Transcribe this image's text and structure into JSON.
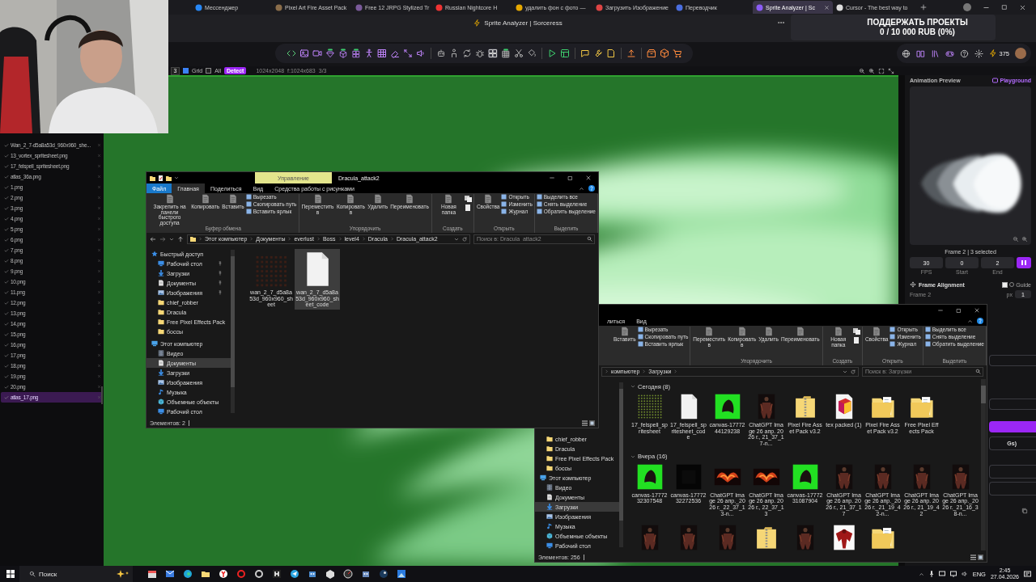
{
  "browser": {
    "tabs": [
      {
        "label": "Мессенджер",
        "selected": false
      },
      {
        "label": "Pixel Art Fire Asset Pack",
        "selected": false
      },
      {
        "label": "Free 12 JRPG Stylized Tr",
        "selected": false
      },
      {
        "label": "Russian Nightcore H",
        "selected": false
      },
      {
        "label": "удалить фон с фото —",
        "selected": false
      },
      {
        "label": "Загрузить Изображение",
        "selected": false
      },
      {
        "label": "Переводчик",
        "selected": false
      },
      {
        "label": "Sprite Analyzer | Sc",
        "selected": true
      },
      {
        "label": "Cursor - The best way to",
        "selected": false
      }
    ],
    "page_title": "Sprite Analyzer | Sorceress"
  },
  "support_banner": {
    "title": "ПОДДЕРЖАТЬ ПРОЕКТЫ",
    "progress": "0 / 10 000 RUB (0%)"
  },
  "toolbar": {
    "credits": "375"
  },
  "canvas_header": {
    "zoom": "3",
    "grid": {
      "label": "Grid",
      "checked": true
    },
    "all": {
      "label": "All",
      "checked": false
    },
    "detect": "Detect",
    "size": "1024x2048",
    "frame_size": "f:1024x683",
    "count": "3/3"
  },
  "file_list": [
    {
      "name": "Wan_2_7-d5a8a53d_960x960_she...",
      "selected": false
    },
    {
      "name": "13_vortex_spritesheet.png",
      "selected": false
    },
    {
      "name": "17_felspell_spritesheet.png",
      "selected": false
    },
    {
      "name": "atlas_36a.png",
      "selected": false
    },
    {
      "name": "1.png",
      "selected": false
    },
    {
      "name": "2.png",
      "selected": false
    },
    {
      "name": "3.png",
      "selected": false
    },
    {
      "name": "4.png",
      "selected": false
    },
    {
      "name": "5.png",
      "selected": false
    },
    {
      "name": "6.png",
      "selected": false
    },
    {
      "name": "7.png",
      "selected": false
    },
    {
      "name": "8.png",
      "selected": false
    },
    {
      "name": "9.png",
      "selected": false
    },
    {
      "name": "10.png",
      "selected": false
    },
    {
      "name": "11.png",
      "selected": false
    },
    {
      "name": "12.png",
      "selected": false
    },
    {
      "name": "13.png",
      "selected": false
    },
    {
      "name": "14.png",
      "selected": false
    },
    {
      "name": "15.png",
      "selected": false
    },
    {
      "name": "16.png",
      "selected": false
    },
    {
      "name": "17.png",
      "selected": false
    },
    {
      "name": "18.png",
      "selected": false
    },
    {
      "name": "19.png",
      "selected": false
    },
    {
      "name": "20.png",
      "selected": false
    },
    {
      "name": "atlas_17.png",
      "selected": true
    }
  ],
  "animation_panel": {
    "title": "Animation Preview",
    "playground": "Playground",
    "frame_info": "Frame 2 | 3 selected",
    "fields": [
      {
        "value": "30",
        "label": "FPS"
      },
      {
        "value": "0",
        "label": "Start"
      },
      {
        "value": "2",
        "label": "End"
      }
    ],
    "alignment": {
      "title": "Frame Alignment",
      "guide": {
        "label": "Guide",
        "checked": false
      },
      "frame": "Frame 2",
      "unit": "px",
      "step": "1"
    },
    "partial_button": "Gs)"
  },
  "explorers": [
    {
      "title": "Dracula_attack2",
      "context_tab": "Управление",
      "ribbon_tabs": [
        {
          "label": "Файл",
          "kind": "file",
          "selected": false
        },
        {
          "label": "Главная",
          "kind": "tab",
          "selected": true
        },
        {
          "label": "Поделиться",
          "kind": "tab",
          "selected": false
        },
        {
          "label": "Вид",
          "kind": "tab",
          "selected": false
        },
        {
          "label": "Средства работы с рисунками",
          "kind": "tab",
          "selected": false
        }
      ],
      "ribbon": [
        {
          "label": "Буфер обмена",
          "kind": "plain",
          "large": [
            "Закрепить на панели быстрого доступа",
            "Копировать",
            "Вставить"
          ],
          "small": [
            "Вырезать",
            "Скопировать путь",
            "Вставить ярлык"
          ]
        },
        {
          "label": "Упорядочить",
          "kind": "plain",
          "large": [
            "Переместить в",
            "Копировать в",
            "Удалить",
            "Переименовать"
          ]
        },
        {
          "label": "Создать",
          "kind": "create",
          "large": [
            "Новая папка"
          ]
        },
        {
          "label": "Открыть",
          "kind": "plain",
          "large": [
            "Свойства"
          ],
          "small": [
            "Открыть",
            "Изменить",
            "Журнал"
          ]
        },
        {
          "label": "Выделить",
          "kind": "plain",
          "small": [
            "Выделить все",
            "Снять выделение",
            "Обратить выделение"
          ]
        }
      ],
      "path": [
        "Этот компьютер",
        "Документы",
        "everlust",
        "Boss",
        "level4",
        "Dracula",
        "Dracula_attack2"
      ],
      "search_placeholder": "Поиск в: Dracula_attack2",
      "nav": [
        {
          "label": "Быстрый доступ",
          "kind": "star",
          "selected": false,
          "children": [
            {
              "label": "Рабочий стол",
              "kind": "desktop",
              "pinned": true,
              "selected": false
            },
            {
              "label": "Загрузки",
              "kind": "download",
              "pinned": true,
              "selected": false
            },
            {
              "label": "Документы",
              "kind": "document",
              "pinned": true,
              "selected": false
            },
            {
              "label": "Изображения",
              "kind": "pictures",
              "pinned": true,
              "selected": false
            },
            {
              "label": "chief_robber",
              "kind": "folder",
              "pinned": false,
              "selected": false
            },
            {
              "label": "Dracula",
              "kind": "folder",
              "pinned": false,
              "selected": false
            },
            {
              "label": "Free Pixel Effects Pack",
              "kind": "folder",
              "pinned": false,
              "selected": false
            },
            {
              "label": "боссы",
              "kind": "folder",
              "pinned": false,
              "selected": false
            }
          ]
        },
        {
          "label": "Этот компьютер",
          "kind": "computer",
          "selected": false,
          "children": [
            {
              "label": "Видео",
              "kind": "video",
              "pinned": false,
              "selected": false
            },
            {
              "label": "Документы",
              "kind": "document",
              "pinned": false,
              "selected": true
            },
            {
              "label": "Загрузки",
              "kind": "download",
              "pinned": false,
              "selected": false
            },
            {
              "label": "Изображения",
              "kind": "pictures",
              "pinned": false,
              "selected": false
            },
            {
              "label": "Музыка",
              "kind": "music",
              "pinned": false,
              "selected": false
            },
            {
              "label": "Объемные объекты",
              "kind": "objects",
              "pinned": false,
              "selected": false
            },
            {
              "label": "Рабочий стол",
              "kind": "desktop",
              "pinned": false,
              "selected": false
            }
          ]
        }
      ],
      "groups": [
        {
          "items": [
            {
              "name": "wan_2_7_d5a8a53d_960x960_sheet",
              "kind": "sheet",
              "selected": false
            },
            {
              "name": "wan_2_7_d5a8a53d_960x960_sheet_code",
              "kind": "document",
              "selected": true
            }
          ]
        }
      ],
      "status": "Элементов: 2"
    },
    {
      "ribbon_tabs": [
        {
          "label": "литься",
          "kind": "tab",
          "selected": false
        },
        {
          "label": "Вид",
          "kind": "tab",
          "selected": false
        }
      ],
      "ribbon": [
        {
          "kind": "plain",
          "large": [
            "Вставить"
          ],
          "small": [
            "Вырезать",
            "Скопировать путь",
            "Вставить ярлык"
          ]
        },
        {
          "label": "Упорядочить",
          "kind": "plain",
          "large": [
            "Переместить в",
            "Копировать в",
            "Удалить",
            "Переименовать"
          ]
        },
        {
          "label": "Создать",
          "kind": "create",
          "large": [
            "Новая папка"
          ]
        },
        {
          "label": "Открыть",
          "kind": "plain",
          "large": [
            "Свойства"
          ],
          "small": [
            "Открыть",
            "Изменить",
            "Журнал"
          ]
        },
        {
          "label": "Выделить",
          "kind": "plain",
          "small": [
            "Выделить все",
            "Снять выделение",
            "Обратить выделение"
          ]
        }
      ],
      "path": [
        "компьютер",
        "Загрузки"
      ],
      "search_placeholder": "Поиск в: Загрузки",
      "nav": [
        {
          "label": "chief_robber",
          "kind": "folder",
          "pinned": false,
          "selected": false
        },
        {
          "label": "Dracula",
          "kind": "folder",
          "pinned": false,
          "selected": false
        },
        {
          "label": "Free Pixel Effects Pack",
          "kind": "folder",
          "pinned": false,
          "selected": false
        },
        {
          "label": "боссы",
          "kind": "folder",
          "pinned": false,
          "selected": false
        },
        {
          "label": "Этот компьютер",
          "kind": "computer",
          "selected": false,
          "children": [
            {
              "label": "Видео",
              "kind": "video",
              "pinned": false,
              "selected": false
            },
            {
              "label": "Документы",
              "kind": "document",
              "pinned": false,
              "selected": false
            },
            {
              "label": "Загрузки",
              "kind": "download",
              "pinned": false,
              "selected": true
            },
            {
              "label": "Изображения",
              "kind": "pictures",
              "pinned": false,
              "selected": false
            },
            {
              "label": "Музыка",
              "kind": "music",
              "pinned": false,
              "selected": false
            },
            {
              "label": "Объемные объекты",
              "kind": "objects",
              "pinned": false,
              "selected": false
            },
            {
              "label": "Рабочий стол",
              "kind": "desktop",
              "pinned": false,
              "selected": false
            }
          ]
        }
      ],
      "groups": [
        {
          "title": "Сегодня (8)",
          "items": [
            {
              "name": "17_felspell_spritesheet",
              "kind": "dotgrid",
              "selected": false
            },
            {
              "name": "17_felspell_spritesheet_code",
              "kind": "document",
              "selected": false
            },
            {
              "name": "canvas-1777244129238",
              "kind": "green",
              "selected": false
            },
            {
              "name": "ChatGPT Image 26 апр. 2026 г., 21_37_17-n...",
              "kind": "figure",
              "selected": false
            },
            {
              "name": "Pixel Fire Asset Pack v3.2",
              "kind": "zip",
              "selected": false
            },
            {
              "name": "tex packed (1)",
              "kind": "package",
              "selected": false
            },
            {
              "name": "Pixel Fire Asset Pack v3.2",
              "kind": "folder",
              "selected": false
            },
            {
              "name": "Free Pixel Effects Pack",
              "kind": "folder",
              "selected": false
            }
          ]
        },
        {
          "title": "Вчера (16)",
          "items": [
            {
              "name": "canvas-1777232307548",
              "kind": "green",
              "selected": false
            },
            {
              "name": "canvas-1777232272536",
              "kind": "black",
              "selected": false
            },
            {
              "name": "ChatGPT Image 26 апр._2026 г._22_37_13-n...",
              "kind": "fire",
              "selected": false
            },
            {
              "name": "ChatGPT Image 26 апр. 2026 г., 22_37_13",
              "kind": "fire",
              "selected": false
            },
            {
              "name": "canvas-1777231087904",
              "kind": "green",
              "selected": false
            },
            {
              "name": "ChatGPT Image 26 апр. 2026 г., 21_37_17",
              "kind": "figure",
              "selected": false
            },
            {
              "name": "ChatGPT Image 26 апр._2026 г._21_19_42-n...",
              "kind": "figure",
              "selected": false
            },
            {
              "name": "ChatGPT Image 26 апр. 2026 г., 21_19_42",
              "kind": "figure",
              "selected": false
            },
            {
              "name": "ChatGPT Image 26 апр._2026 г._21_16_38-n...",
              "kind": "figure",
              "selected": false
            },
            {
              "kind": "figure",
              "selected": false
            },
            {
              "kind": "figure",
              "selected": false
            },
            {
              "kind": "figure",
              "selected": false
            },
            {
              "kind": "zip",
              "selected": false
            },
            {
              "kind": "figure",
              "selected": false
            },
            {
              "kind": "demon",
              "selected": false
            },
            {
              "kind": "folder",
              "selected": false
            }
          ]
        }
      ],
      "status": "Элементов: 256"
    }
  ],
  "taskbar": {
    "search_placeholder": "Поиск",
    "language": "ENG",
    "time": "2:45",
    "date": "27.04.2026"
  }
}
